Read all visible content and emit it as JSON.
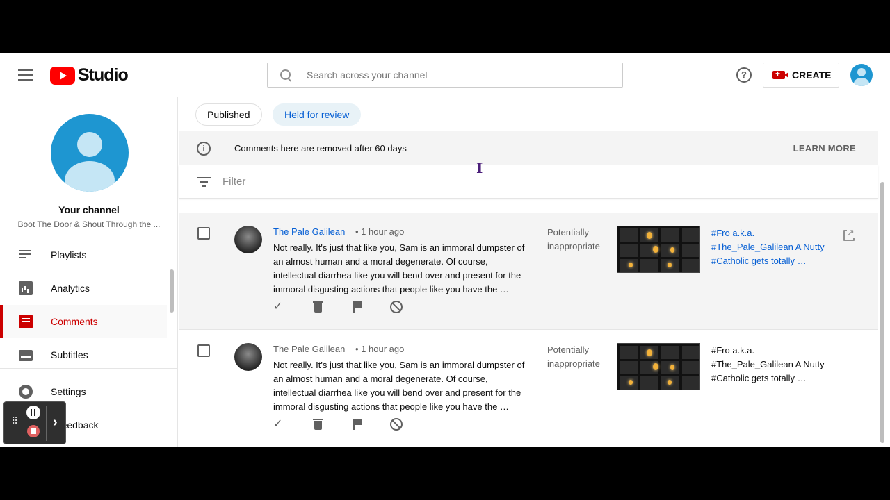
{
  "header": {
    "logo_text": "Studio",
    "search_placeholder": "Search across your channel",
    "create_label": "CREATE",
    "help_glyph": "?"
  },
  "sidebar": {
    "channel_title": "Your channel",
    "channel_name": "Boot The Door & Shout Through the ...",
    "items": [
      {
        "label": "Playlists",
        "icon": "playlists-icon"
      },
      {
        "label": "Analytics",
        "icon": "analytics-icon"
      },
      {
        "label": "Comments",
        "icon": "comments-icon",
        "active": true
      },
      {
        "label": "Subtitles",
        "icon": "subtitles-icon"
      },
      {
        "label": "Settings",
        "icon": "settings-icon"
      },
      {
        "label": "d feedback",
        "icon": "feedback-icon"
      }
    ]
  },
  "tabs": {
    "published": "Published",
    "held": "Held for review"
  },
  "banner": {
    "info_glyph": "i",
    "message": "Comments here are removed after 60 days",
    "learn_more": "LEARN MORE"
  },
  "filter": {
    "label": "Filter"
  },
  "comments": [
    {
      "author": "The Pale Galilean",
      "time": "• 1 hour ago",
      "text": "Not really. It's just that like you, Sam is an immoral dumpster of an almost human and a moral degenerate.  Of course, intellectual diarrhea like you will bend over and present for the immoral disgusting actions that people like you have the …",
      "reason": "Potentially inappropriate",
      "video_title": "#Fro a.k.a. #The_Pale_Galilean A Nutty #Catholic gets totally …"
    },
    {
      "author": "The Pale Galilean",
      "time": "• 1 hour ago",
      "text": "Not really. It's just that like you, Sam is an immoral dumpster of an almost human and a moral degenerate.  Of course, intellectual diarrhea like you will bend over and present for the immoral disgusting actions that people like you have the …",
      "reason": "Potentially inappropriate",
      "video_title": "#Fro a.k.a. #The_Pale_Galilean A Nutty #Catholic gets totally …"
    }
  ],
  "action_glyphs": {
    "approve": "✓"
  },
  "recorder": {
    "arrow": "›"
  },
  "colors": {
    "brand_red": "#ff0000",
    "accent_red": "#cc0000",
    "link_blue": "#065fd4",
    "avatar_blue": "#1e96d1"
  }
}
